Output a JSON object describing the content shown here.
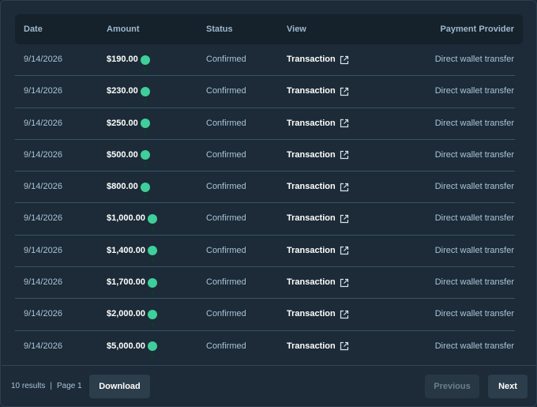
{
  "table": {
    "headers": {
      "date": "Date",
      "amount": "Amount",
      "status": "Status",
      "view": "View",
      "provider": "Payment Provider"
    },
    "token_icon": "tether-icon",
    "rows": [
      {
        "date": "9/14/2026",
        "amount": "$190.00",
        "status": "Confirmed",
        "view": "Transaction",
        "provider": "Direct wallet transfer"
      },
      {
        "date": "9/14/2026",
        "amount": "$230.00",
        "status": "Confirmed",
        "view": "Transaction",
        "provider": "Direct wallet transfer"
      },
      {
        "date": "9/14/2026",
        "amount": "$250.00",
        "status": "Confirmed",
        "view": "Transaction",
        "provider": "Direct wallet transfer"
      },
      {
        "date": "9/14/2026",
        "amount": "$500.00",
        "status": "Confirmed",
        "view": "Transaction",
        "provider": "Direct wallet transfer"
      },
      {
        "date": "9/14/2026",
        "amount": "$800.00",
        "status": "Confirmed",
        "view": "Transaction",
        "provider": "Direct wallet transfer"
      },
      {
        "date": "9/14/2026",
        "amount": "$1,000.00",
        "status": "Confirmed",
        "view": "Transaction",
        "provider": "Direct wallet transfer"
      },
      {
        "date": "9/14/2026",
        "amount": "$1,400.00",
        "status": "Confirmed",
        "view": "Transaction",
        "provider": "Direct wallet transfer"
      },
      {
        "date": "9/14/2026",
        "amount": "$1,700.00",
        "status": "Confirmed",
        "view": "Transaction",
        "provider": "Direct wallet transfer"
      },
      {
        "date": "9/14/2026",
        "amount": "$2,000.00",
        "status": "Confirmed",
        "view": "Transaction",
        "provider": "Direct wallet transfer"
      },
      {
        "date": "9/14/2026",
        "amount": "$5,000.00",
        "status": "Confirmed",
        "view": "Transaction",
        "provider": "Direct wallet transfer"
      }
    ]
  },
  "footer": {
    "results": "10 results",
    "separator": "|",
    "page": "Page 1",
    "download_label": "Download",
    "previous_label": "Previous",
    "next_label": "Next"
  },
  "colors": {
    "background": "#1c2b37",
    "header_bg": "#15212b",
    "token_green": "#3fcf9a",
    "divider": "#35566a"
  }
}
